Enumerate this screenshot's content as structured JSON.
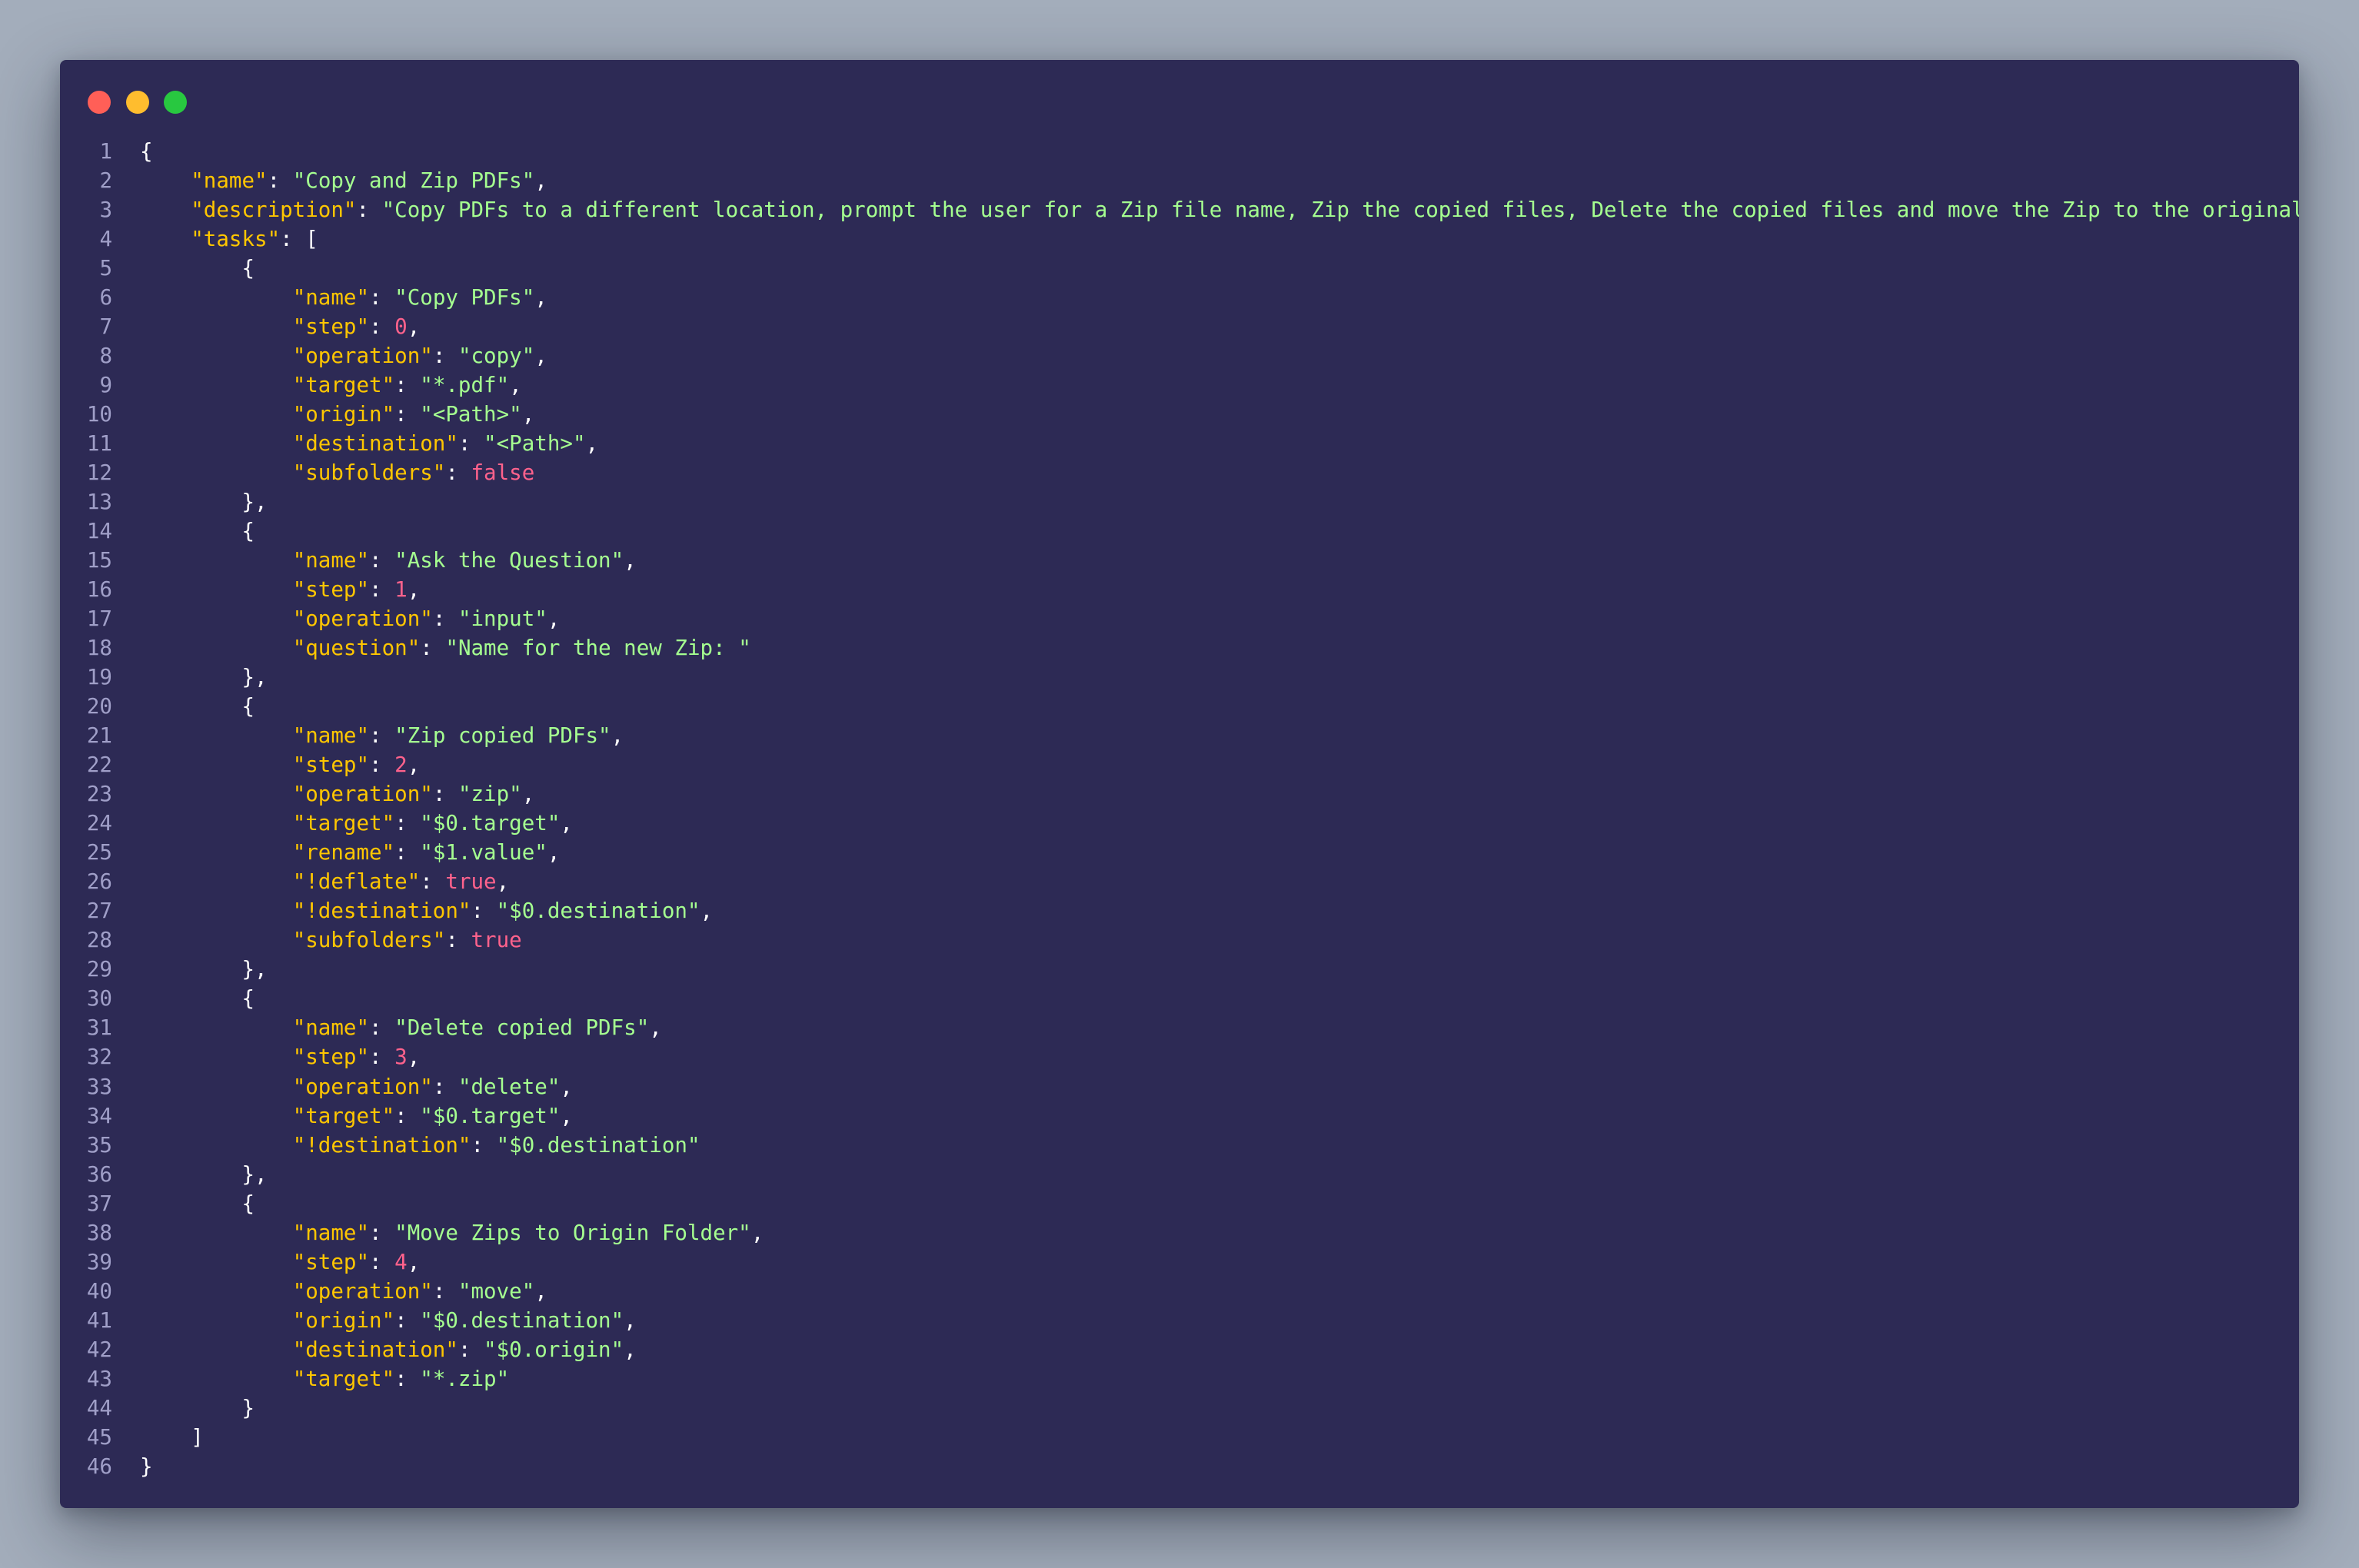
{
  "window": {
    "colors": {
      "background": "#2d2a55",
      "line_number": "#a09fc8",
      "punctuation": "#ffffff",
      "key": "#ffc600",
      "string": "#a5ff90",
      "number_bool": "#ff628c",
      "close": "#ff5f57",
      "minimize": "#ffbd2e",
      "maximize": "#28c840"
    },
    "buttons": {
      "close": "close-icon",
      "minimize": "minimize-icon",
      "maximize": "maximize-icon"
    }
  },
  "code": {
    "language": "json",
    "lines": [
      {
        "n": "1",
        "indent": 0,
        "tokens": [
          [
            "p",
            "{"
          ]
        ]
      },
      {
        "n": "2",
        "indent": 1,
        "tokens": [
          [
            "k",
            "\"name\""
          ],
          [
            "p",
            ": "
          ],
          [
            "s",
            "\"Copy and Zip PDFs\""
          ],
          [
            "p",
            ","
          ]
        ]
      },
      {
        "n": "3",
        "indent": 1,
        "tokens": [
          [
            "k",
            "\"description\""
          ],
          [
            "p",
            ": "
          ],
          [
            "s",
            "\"Copy PDFs to a different location, prompt the user for a Zip file name, Zip the copied files, Delete the copied files and move the Zip to the original folder\""
          ],
          [
            "p",
            ","
          ]
        ]
      },
      {
        "n": "4",
        "indent": 1,
        "tokens": [
          [
            "k",
            "\"tasks\""
          ],
          [
            "p",
            ": ["
          ]
        ]
      },
      {
        "n": "5",
        "indent": 2,
        "tokens": [
          [
            "p",
            "{"
          ]
        ]
      },
      {
        "n": "6",
        "indent": 3,
        "tokens": [
          [
            "k",
            "\"name\""
          ],
          [
            "p",
            ": "
          ],
          [
            "s",
            "\"Copy PDFs\""
          ],
          [
            "p",
            ","
          ]
        ]
      },
      {
        "n": "7",
        "indent": 3,
        "tokens": [
          [
            "k",
            "\"step\""
          ],
          [
            "p",
            ": "
          ],
          [
            "v",
            "0"
          ],
          [
            "p",
            ","
          ]
        ]
      },
      {
        "n": "8",
        "indent": 3,
        "tokens": [
          [
            "k",
            "\"operation\""
          ],
          [
            "p",
            ": "
          ],
          [
            "s",
            "\"copy\""
          ],
          [
            "p",
            ","
          ]
        ]
      },
      {
        "n": "9",
        "indent": 3,
        "tokens": [
          [
            "k",
            "\"target\""
          ],
          [
            "p",
            ": "
          ],
          [
            "s",
            "\"*.pdf\""
          ],
          [
            "p",
            ","
          ]
        ]
      },
      {
        "n": "10",
        "indent": 3,
        "tokens": [
          [
            "k",
            "\"origin\""
          ],
          [
            "p",
            ": "
          ],
          [
            "s",
            "\"<Path>\""
          ],
          [
            "p",
            ","
          ]
        ]
      },
      {
        "n": "11",
        "indent": 3,
        "tokens": [
          [
            "k",
            "\"destination\""
          ],
          [
            "p",
            ": "
          ],
          [
            "s",
            "\"<Path>\""
          ],
          [
            "p",
            ","
          ]
        ]
      },
      {
        "n": "12",
        "indent": 3,
        "tokens": [
          [
            "k",
            "\"subfolders\""
          ],
          [
            "p",
            ": "
          ],
          [
            "v",
            "false"
          ]
        ]
      },
      {
        "n": "13",
        "indent": 2,
        "tokens": [
          [
            "p",
            "},"
          ]
        ]
      },
      {
        "n": "14",
        "indent": 2,
        "tokens": [
          [
            "p",
            "{"
          ]
        ]
      },
      {
        "n": "15",
        "indent": 3,
        "tokens": [
          [
            "k",
            "\"name\""
          ],
          [
            "p",
            ": "
          ],
          [
            "s",
            "\"Ask the Question\""
          ],
          [
            "p",
            ","
          ]
        ]
      },
      {
        "n": "16",
        "indent": 3,
        "tokens": [
          [
            "k",
            "\"step\""
          ],
          [
            "p",
            ": "
          ],
          [
            "v",
            "1"
          ],
          [
            "p",
            ","
          ]
        ]
      },
      {
        "n": "17",
        "indent": 3,
        "tokens": [
          [
            "k",
            "\"operation\""
          ],
          [
            "p",
            ": "
          ],
          [
            "s",
            "\"input\""
          ],
          [
            "p",
            ","
          ]
        ]
      },
      {
        "n": "18",
        "indent": 3,
        "tokens": [
          [
            "k",
            "\"question\""
          ],
          [
            "p",
            ": "
          ],
          [
            "s",
            "\"Name for the new Zip: \""
          ]
        ]
      },
      {
        "n": "19",
        "indent": 2,
        "tokens": [
          [
            "p",
            "},"
          ]
        ]
      },
      {
        "n": "20",
        "indent": 2,
        "tokens": [
          [
            "p",
            "{"
          ]
        ]
      },
      {
        "n": "21",
        "indent": 3,
        "tokens": [
          [
            "k",
            "\"name\""
          ],
          [
            "p",
            ": "
          ],
          [
            "s",
            "\"Zip copied PDFs\""
          ],
          [
            "p",
            ","
          ]
        ]
      },
      {
        "n": "22",
        "indent": 3,
        "tokens": [
          [
            "k",
            "\"step\""
          ],
          [
            "p",
            ": "
          ],
          [
            "v",
            "2"
          ],
          [
            "p",
            ","
          ]
        ]
      },
      {
        "n": "23",
        "indent": 3,
        "tokens": [
          [
            "k",
            "\"operation\""
          ],
          [
            "p",
            ": "
          ],
          [
            "s",
            "\"zip\""
          ],
          [
            "p",
            ","
          ]
        ]
      },
      {
        "n": "24",
        "indent": 3,
        "tokens": [
          [
            "k",
            "\"target\""
          ],
          [
            "p",
            ": "
          ],
          [
            "s",
            "\"$0.target\""
          ],
          [
            "p",
            ","
          ]
        ]
      },
      {
        "n": "25",
        "indent": 3,
        "tokens": [
          [
            "k",
            "\"rename\""
          ],
          [
            "p",
            ": "
          ],
          [
            "s",
            "\"$1.value\""
          ],
          [
            "p",
            ","
          ]
        ]
      },
      {
        "n": "26",
        "indent": 3,
        "tokens": [
          [
            "k",
            "\"!deflate\""
          ],
          [
            "p",
            ": "
          ],
          [
            "v",
            "true"
          ],
          [
            "p",
            ","
          ]
        ]
      },
      {
        "n": "27",
        "indent": 3,
        "tokens": [
          [
            "k",
            "\"!destination\""
          ],
          [
            "p",
            ": "
          ],
          [
            "s",
            "\"$0.destination\""
          ],
          [
            "p",
            ","
          ]
        ]
      },
      {
        "n": "28",
        "indent": 3,
        "tokens": [
          [
            "k",
            "\"subfolders\""
          ],
          [
            "p",
            ": "
          ],
          [
            "v",
            "true"
          ]
        ]
      },
      {
        "n": "29",
        "indent": 2,
        "tokens": [
          [
            "p",
            "},"
          ]
        ]
      },
      {
        "n": "30",
        "indent": 2,
        "tokens": [
          [
            "p",
            "{"
          ]
        ]
      },
      {
        "n": "31",
        "indent": 3,
        "tokens": [
          [
            "k",
            "\"name\""
          ],
          [
            "p",
            ": "
          ],
          [
            "s",
            "\"Delete copied PDFs\""
          ],
          [
            "p",
            ","
          ]
        ]
      },
      {
        "n": "32",
        "indent": 3,
        "tokens": [
          [
            "k",
            "\"step\""
          ],
          [
            "p",
            ": "
          ],
          [
            "v",
            "3"
          ],
          [
            "p",
            ","
          ]
        ]
      },
      {
        "n": "33",
        "indent": 3,
        "tokens": [
          [
            "k",
            "\"operation\""
          ],
          [
            "p",
            ": "
          ],
          [
            "s",
            "\"delete\""
          ],
          [
            "p",
            ","
          ]
        ]
      },
      {
        "n": "34",
        "indent": 3,
        "tokens": [
          [
            "k",
            "\"target\""
          ],
          [
            "p",
            ": "
          ],
          [
            "s",
            "\"$0.target\""
          ],
          [
            "p",
            ","
          ]
        ]
      },
      {
        "n": "35",
        "indent": 3,
        "tokens": [
          [
            "k",
            "\"!destination\""
          ],
          [
            "p",
            ": "
          ],
          [
            "s",
            "\"$0.destination\""
          ]
        ]
      },
      {
        "n": "36",
        "indent": 2,
        "tokens": [
          [
            "p",
            "},"
          ]
        ]
      },
      {
        "n": "37",
        "indent": 2,
        "tokens": [
          [
            "p",
            "{"
          ]
        ]
      },
      {
        "n": "38",
        "indent": 3,
        "tokens": [
          [
            "k",
            "\"name\""
          ],
          [
            "p",
            ": "
          ],
          [
            "s",
            "\"Move Zips to Origin Folder\""
          ],
          [
            "p",
            ","
          ]
        ]
      },
      {
        "n": "39",
        "indent": 3,
        "tokens": [
          [
            "k",
            "\"step\""
          ],
          [
            "p",
            ": "
          ],
          [
            "v",
            "4"
          ],
          [
            "p",
            ","
          ]
        ]
      },
      {
        "n": "40",
        "indent": 3,
        "tokens": [
          [
            "k",
            "\"operation\""
          ],
          [
            "p",
            ": "
          ],
          [
            "s",
            "\"move\""
          ],
          [
            "p",
            ","
          ]
        ]
      },
      {
        "n": "41",
        "indent": 3,
        "tokens": [
          [
            "k",
            "\"origin\""
          ],
          [
            "p",
            ": "
          ],
          [
            "s",
            "\"$0.destination\""
          ],
          [
            "p",
            ","
          ]
        ]
      },
      {
        "n": "42",
        "indent": 3,
        "tokens": [
          [
            "k",
            "\"destination\""
          ],
          [
            "p",
            ": "
          ],
          [
            "s",
            "\"$0.origin\""
          ],
          [
            "p",
            ","
          ]
        ]
      },
      {
        "n": "43",
        "indent": 3,
        "tokens": [
          [
            "k",
            "\"target\""
          ],
          [
            "p",
            ": "
          ],
          [
            "s",
            "\"*.zip\""
          ]
        ]
      },
      {
        "n": "44",
        "indent": 2,
        "tokens": [
          [
            "p",
            "}"
          ]
        ]
      },
      {
        "n": "45",
        "indent": 1,
        "tokens": [
          [
            "p",
            "]"
          ]
        ]
      },
      {
        "n": "46",
        "indent": 0,
        "tokens": [
          [
            "p",
            "}"
          ]
        ]
      }
    ]
  }
}
